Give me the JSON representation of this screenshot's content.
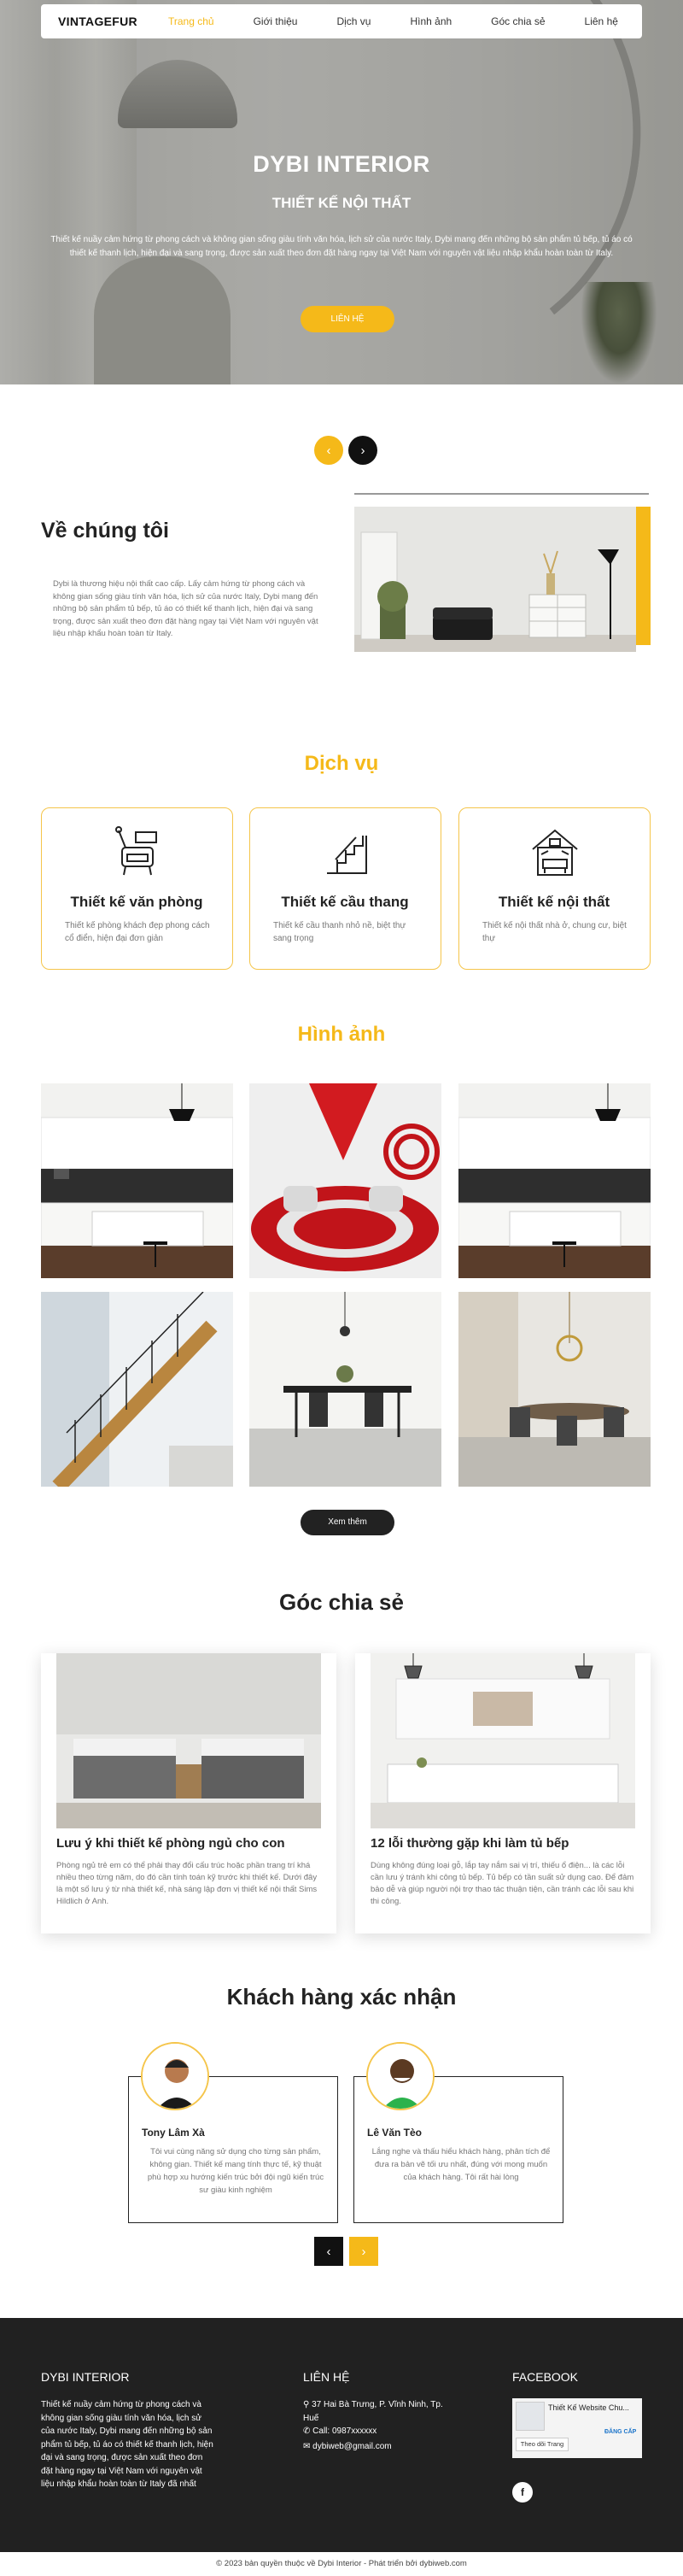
{
  "nav": {
    "logo": "VINTAGEFUR",
    "items": [
      "Trang chủ",
      "Giới thiệu",
      "Dịch vụ",
      "Hình ảnh",
      "Góc chia sẻ",
      "Liên hệ"
    ]
  },
  "hero": {
    "title": "DYBI INTERIOR",
    "subtitle": "THIẾT KẾ NỘI THẤT",
    "description": "Thiết kế nuầy cảm hứng từ phong cách và không gian sống giàu tính văn hóa, lịch sử của nước Italy, Dybi mang đến những bộ sản phẩm tủ bếp, tủ áo có thiết kế thanh lịch, hiện đại và sang trọng, được sản xuất theo đơn đặt hàng ngay tại Việt Nam với nguyên vật liệu nhập khẩu hoàn toàn từ Italy.",
    "button": "LIÊN HỆ"
  },
  "slider_arrows": {
    "prev": "‹",
    "next": "›"
  },
  "about": {
    "title": "Về chúng tôi",
    "text": "Dybi là thương hiệu nội thất cao cấp. Lấy cảm hứng từ phong cách và không gian sống giàu tính văn hóa, lịch sử của nước Italy, Dybi mang đến những bộ sản phẩm tủ bếp, tủ áo có thiết kế thanh lịch, hiện đại và sang trọng, được sản xuất theo đơn đặt hàng ngay tại Việt Nam với nguyên vật liệu nhập khẩu hoàn toàn từ Italy."
  },
  "services": {
    "title": "Dịch vụ",
    "items": [
      {
        "title": "Thiết kế văn phòng",
        "desc": "Thiết kế phòng khách đẹp phong cách cổ điển, hiện đại đơn giản",
        "icon": "office-chair-icon"
      },
      {
        "title": "Thiết kế cầu thang",
        "desc": "Thiết kế cầu thanh nhỏ nề, biệt thự sang trọng",
        "icon": "stairs-icon"
      },
      {
        "title": "Thiết kế nội thất",
        "desc": "Thiết kế nội thất nhà ở, chung cư, biệt thự",
        "icon": "house-interior-icon"
      }
    ]
  },
  "gallery": {
    "title": "Hình ảnh",
    "button": "Xem thêm"
  },
  "blog": {
    "title": "Góc chia sẻ",
    "posts": [
      {
        "title": "Lưu ý khi thiết kế phòng ngủ cho con",
        "desc": "Phòng ngủ trẻ em có thể phải thay đổi cấu trúc hoặc phần trang trí khá nhiều theo từng năm, do đó cần tính toán kỹ trước khi thiết kế. Dưới đây là một số lưu ý từ nhà thiết kế, nhà sáng lập đơn vị thiết kế nội thất Sims Hildlich ở Anh."
      },
      {
        "title": "12 lỗi thường gặp khi làm tủ bếp",
        "desc": "Dùng không đúng loại gỗ, lắp tay nắm sai vị trí, thiếu ổ điện... là các lỗi cần lưu ý tránh khi công tủ bếp. Tủ bếp có tần suất sử dụng cao. Để đảm bảo dễ và giúp người nội trợ thao tác thuận tiện, cần tránh các lỗi sau khi thi công."
      }
    ]
  },
  "testimonials": {
    "title": "Khách hàng xác nhận",
    "items": [
      {
        "name": "Tony Lâm Xà",
        "text": "Tôi vui cùng năng sử dụng cho từng sản phẩm, không gian. Thiết kế mang tính thực tế, kỹ thuật phù hợp xu hướng kiến trúc bởi đội ngũ kiến trúc sư giàu kinh nghiệm"
      },
      {
        "name": "Lê Văn Tèo",
        "text": "Lắng nghe và thấu hiểu khách hàng, phân tích để đưa ra bản vẽ tối ưu nhất, đúng với mong muốn của khách hàng. Tôi rất hài lòng"
      }
    ],
    "prev": "‹",
    "next": "›"
  },
  "footer": {
    "col1_title": "DYBI INTERIOR",
    "col1_text": "Thiết kế nuầy cảm hứng từ phong cách và không gian sống giàu tính văn hóa, lịch sử của nước Italy, Dybi mang đến những bộ sản phẩm tủ bếp, tủ áo có thiết kế thanh lịch, hiện đại và sang trọng, được sản xuất theo đơn đặt hàng ngay tại Việt Nam với nguyên vật liệu nhập khẩu hoàn toàn từ Italy đã nhất",
    "col2_title": "LIÊN HỆ",
    "address": "37 Hai Bà Trưng, P. Vĩnh Ninh, Tp. Huế",
    "phone": "Call: 0987xxxxxx",
    "email": "dybiweb@gmail.com",
    "col3_title": "FACEBOOK",
    "fb_page_name": "Thiết Kế Website Chu...",
    "fb_follow": "Theo dõi Trang",
    "fb_badge": "ĐĂNG CẤP",
    "fb_icon": "facebook-icon"
  },
  "copyright": "© 2023 bản quyền thuộc về Dybi Interior - Phát triển bởi dybiweb.com",
  "colors": {
    "accent": "#f5b919",
    "dark": "#212121"
  }
}
